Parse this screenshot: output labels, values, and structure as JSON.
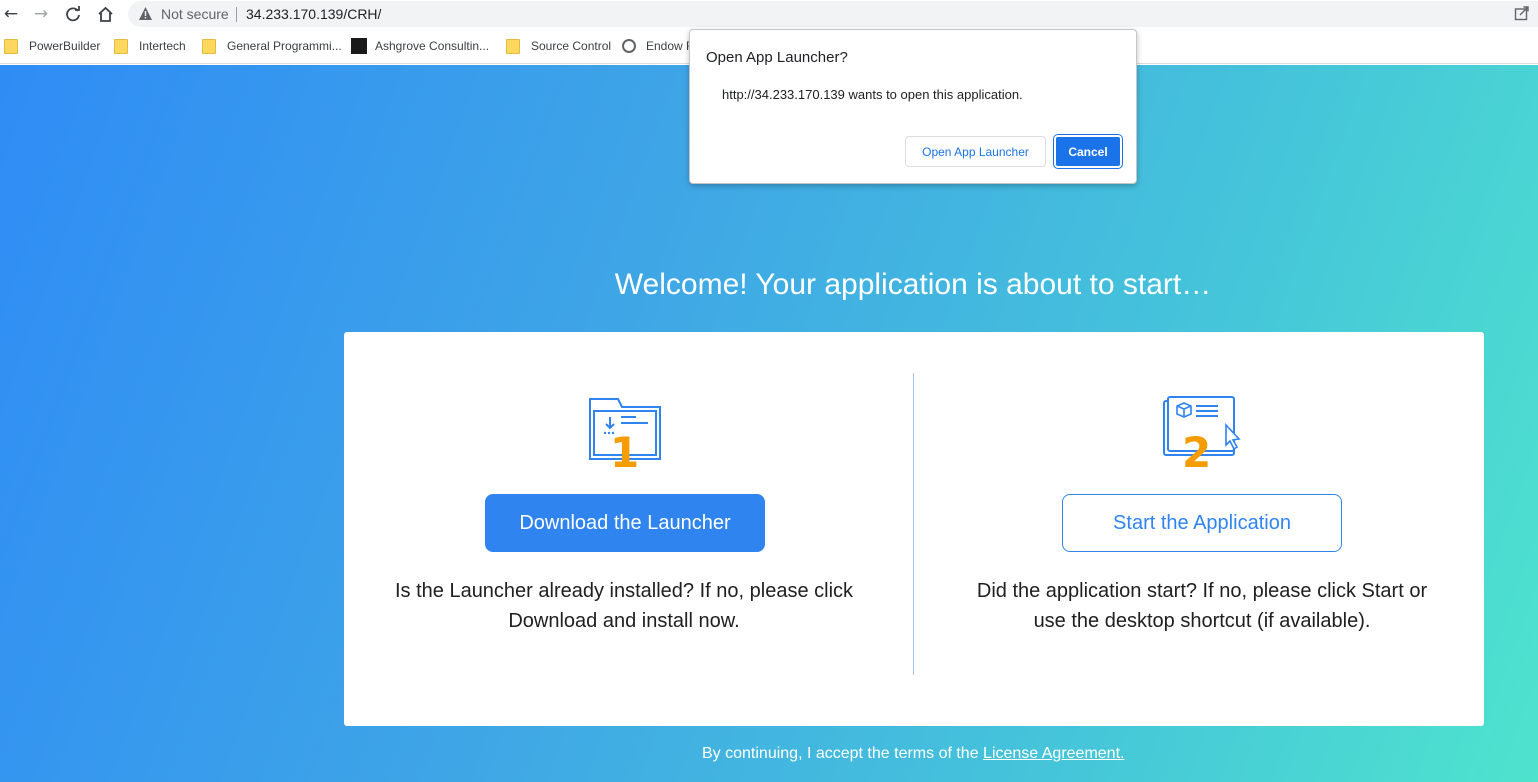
{
  "browser": {
    "security_label": "Not secure",
    "url": "34.233.170.139/CRH/",
    "icons": {
      "back": "back-arrow-icon",
      "forward": "forward-arrow-icon",
      "reload": "reload-icon",
      "home": "home-icon",
      "warning": "warning-triangle-icon",
      "share": "share-icon"
    }
  },
  "bookmarks": [
    {
      "label": "PowerBuilder",
      "icon": "folder-icon"
    },
    {
      "label": "Intertech",
      "icon": "folder-icon"
    },
    {
      "label": "General Programmi...",
      "icon": "folder-icon"
    },
    {
      "label": "Ashgrove Consultin...",
      "icon": "site-favicon"
    },
    {
      "label": "Source Control",
      "icon": "folder-icon"
    },
    {
      "label": "Endow F",
      "icon": "globe-icon"
    }
  ],
  "page": {
    "welcome": "Welcome! Your application is about to start…",
    "step1": {
      "number": "1",
      "button": "Download the Launcher",
      "text": "Is the Launcher already installed? If no, please click Download and install now."
    },
    "step2": {
      "number": "2",
      "button": "Start the Application",
      "text": "Did the application start? If no, please click Start or use the desktop shortcut (if available)."
    },
    "footer_text": "By continuing, I accept the terms of the ",
    "footer_link": "License Agreement."
  },
  "dialog": {
    "title": "Open App Launcher?",
    "message": "http://34.233.170.139 wants to open this application.",
    "open_button": "Open App Launcher",
    "cancel_button": "Cancel"
  },
  "colors": {
    "primary": "#2f84f0",
    "accent_number": "#f59c00",
    "dialog_primary": "#1a73e8",
    "gradient_start": "#2f8cf5",
    "gradient_end": "#4ee3cd"
  }
}
